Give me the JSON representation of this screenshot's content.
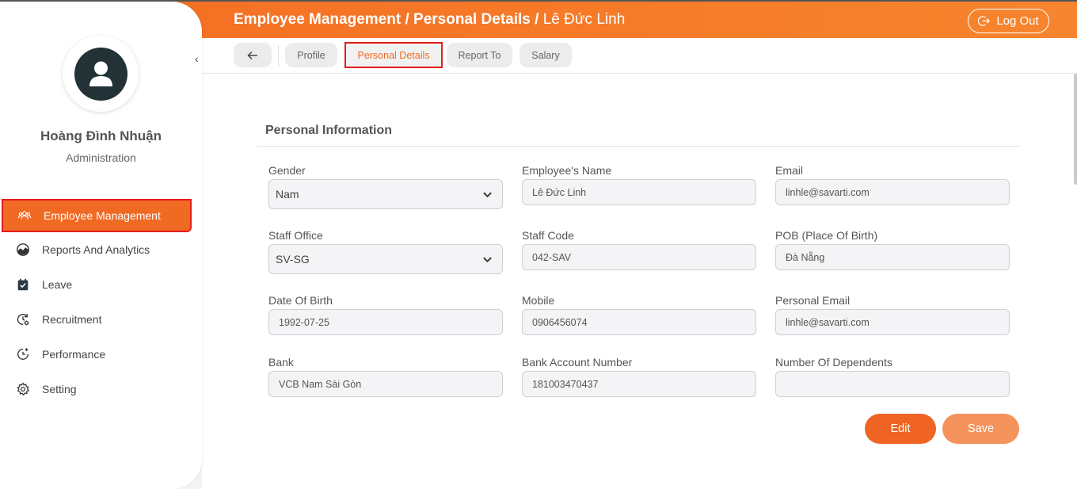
{
  "header": {
    "breadcrumb_part1": "Employee Management",
    "breadcrumb_sep1": " / ",
    "breadcrumb_part2": "Personal Details",
    "breadcrumb_sep2": " / ",
    "breadcrumb_part3": "Lê Đức Linh",
    "logout_label": "Log Out"
  },
  "tabs": [
    {
      "label": "Profile"
    },
    {
      "label": "Personal Details",
      "active": true
    },
    {
      "label": "Report To"
    },
    {
      "label": "Salary"
    }
  ],
  "sidebar": {
    "user_name": "Hoàng Đình Nhuận",
    "user_role": "Administration",
    "items": [
      {
        "label": "Employee Management",
        "icon": "users-icon",
        "active": true
      },
      {
        "label": "Reports And Analytics",
        "icon": "chart-icon"
      },
      {
        "label": "Leave",
        "icon": "calendar-check-icon"
      },
      {
        "label": "Recruitment",
        "icon": "recruitment-icon"
      },
      {
        "label": "Performance",
        "icon": "performance-icon"
      },
      {
        "label": "Setting",
        "icon": "gear-icon"
      }
    ]
  },
  "form": {
    "section_title": "Personal Information",
    "fields": {
      "gender": {
        "label": "Gender",
        "value": "Nam"
      },
      "employee_name": {
        "label": "Employee's Name",
        "value": "Lê Đức Linh"
      },
      "email": {
        "label": "Email",
        "value": "linhle@savarti.com"
      },
      "staff_office": {
        "label": "Staff Office",
        "value": "SV-SG"
      },
      "staff_code": {
        "label": "Staff Code",
        "value": "042-SAV"
      },
      "pob": {
        "label": "POB (Place Of Birth)",
        "value": "Đà Nẵng"
      },
      "dob": {
        "label": "Date Of Birth",
        "value": "1992-07-25"
      },
      "mobile": {
        "label": "Mobile",
        "value": "0906456074"
      },
      "personal_email": {
        "label": "Personal Email",
        "value": "linhle@savarti.com"
      },
      "bank": {
        "label": "Bank",
        "value": "VCB Nam Sài Gòn"
      },
      "bank_account": {
        "label": "Bank Account Number",
        "value": "181003470437"
      },
      "dependents": {
        "label": "Number Of Dependents",
        "value": ""
      }
    },
    "edit_label": "Edit",
    "save_label": "Save"
  },
  "colors": {
    "accent": "#f26b21",
    "highlight_border": "#e51c1c",
    "avatar_bg": "#233236"
  }
}
